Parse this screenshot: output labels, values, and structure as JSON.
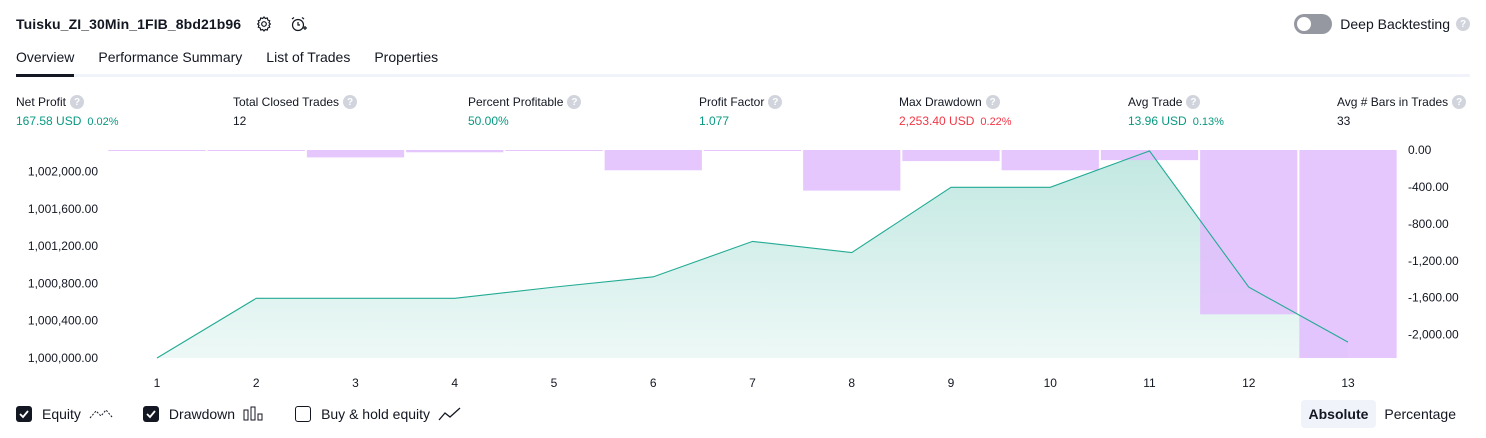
{
  "header": {
    "title": "Tuisku_ZI_30Min_1FIB_8bd21b96",
    "settings_icon": "gear-icon",
    "alarm_icon": "alarm-add-icon"
  },
  "deep_backtesting": {
    "label": "Deep Backtesting",
    "enabled": false,
    "help": "?"
  },
  "tabs": [
    {
      "label": "Overview",
      "active": true
    },
    {
      "label": "Performance Summary",
      "active": false
    },
    {
      "label": "List of Trades",
      "active": false
    },
    {
      "label": "Properties",
      "active": false
    }
  ],
  "metrics": [
    {
      "label": "Net Profit",
      "value": "167.58 USD",
      "pct": "0.02%",
      "tone": "pos"
    },
    {
      "label": "Total Closed Trades",
      "value": "12",
      "pct": "",
      "tone": "neu"
    },
    {
      "label": "Percent Profitable",
      "value": "50.00%",
      "pct": "",
      "tone": "pos"
    },
    {
      "label": "Profit Factor",
      "value": "1.077",
      "pct": "",
      "tone": "pos"
    },
    {
      "label": "Max Drawdown",
      "value": "2,253.40 USD",
      "pct": "0.22%",
      "tone": "neg"
    },
    {
      "label": "Avg Trade",
      "value": "13.96 USD",
      "pct": "0.13%",
      "tone": "pos"
    },
    {
      "label": "Avg # Bars in Trades",
      "value": "33",
      "pct": "",
      "tone": "neu"
    }
  ],
  "colors": {
    "equity_line": "#22ab94",
    "equity_fill": "#b3e6d9",
    "drawdown_bar": "#e1bcfd",
    "positive": "#089981",
    "negative": "#f23645"
  },
  "chart_data": {
    "type": "area",
    "x": [
      1,
      2,
      3,
      4,
      5,
      6,
      7,
      8,
      9,
      10,
      11,
      12,
      13
    ],
    "x_ticks": [
      "1",
      "2",
      "3",
      "4",
      "5",
      "6",
      "7",
      "8",
      "9",
      "10",
      "11",
      "12",
      "13"
    ],
    "series": [
      {
        "name": "Equity",
        "type": "area",
        "axis": "left",
        "values": [
          1000000,
          1000640,
          1000640,
          1000640,
          1000760,
          1000870,
          1001250,
          1001130,
          1001830,
          1001830,
          1002220,
          1000760,
          1000170
        ]
      },
      {
        "name": "Drawdown",
        "type": "bar",
        "axis": "right",
        "values": [
          -5,
          -5,
          -80,
          -25,
          -10,
          -220,
          -10,
          -440,
          -120,
          -220,
          -110,
          -1780,
          -2253.4
        ]
      }
    ],
    "y_left": {
      "ticks": [
        "1,000,000.00",
        "1,000,400.00",
        "1,000,800.00",
        "1,001,200.00",
        "1,001,600.00",
        "1,002,000.00"
      ],
      "tick_values": [
        1000000,
        1000400,
        1000800,
        1001200,
        1001600,
        1002000
      ],
      "range": [
        1000000,
        1002230
      ]
    },
    "y_right": {
      "ticks": [
        "0.00",
        "-400.00",
        "-800.00",
        "-1,200.00",
        "-1,600.00",
        "-2,000.00"
      ],
      "tick_values": [
        0,
        -400,
        -800,
        -1200,
        -1600,
        -2000
      ],
      "range": [
        -2253.4,
        0
      ]
    },
    "grid": false
  },
  "legend": [
    {
      "label": "Equity",
      "checked": true,
      "icon": "equity-line-icon"
    },
    {
      "label": "Drawdown",
      "checked": true,
      "icon": "drawdown-bars-icon"
    },
    {
      "label": "Buy & hold equity",
      "checked": false,
      "icon": "buy-hold-line-icon"
    }
  ],
  "mode": {
    "absolute": "Absolute",
    "percentage": "Percentage",
    "selected": "absolute"
  }
}
